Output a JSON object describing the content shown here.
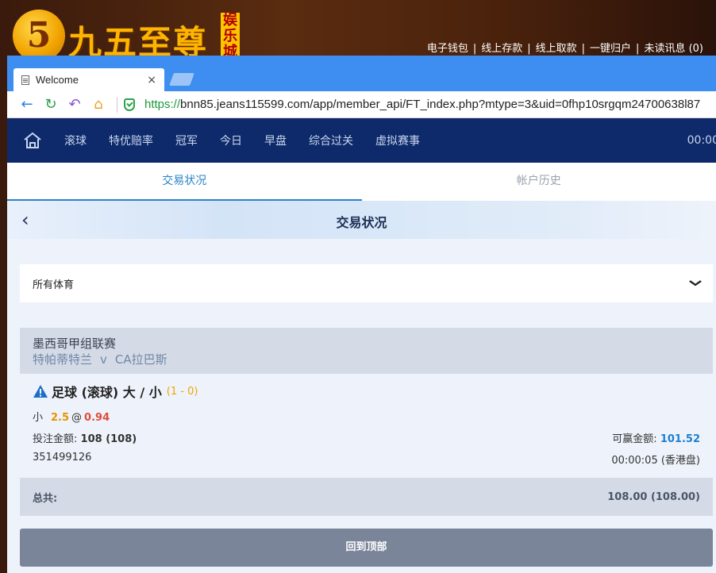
{
  "site": {
    "logo_digit": "5",
    "logo_text": "九五至尊",
    "logo_sub": "娱乐城",
    "links": [
      "电子钱包",
      "线上存款",
      "线上取款",
      "一键归户",
      "未读讯息 (0)"
    ],
    "separator": "|"
  },
  "browser": {
    "tab_title": "Welcome",
    "tab_close": "×",
    "url_scheme": "https://",
    "url_rest": "bnn85.jeans115599.com/app/member_api/FT_index.php?mtype=3&uid=0fhp10srgqm24700638l87"
  },
  "nav": {
    "items": [
      "滚球",
      "特优赔率",
      "冠军",
      "今日",
      "早盘",
      "综合过关",
      "虚拟赛事"
    ],
    "time": "00:00"
  },
  "subtabs": [
    "交易状况",
    "帐户历史"
  ],
  "header": {
    "back_glyph": "‹",
    "title": "交易状况"
  },
  "filter": {
    "selected": "所有体育",
    "chevron": "⌄"
  },
  "bet": {
    "league": "墨西哥甲组联赛",
    "home_team": "特帕蒂特兰",
    "vs": "v",
    "away_team": "CA拉巴斯",
    "market": "足球 (滚球) 大 / 小",
    "score": "(1 - 0)",
    "pick": "小",
    "line": "2.5",
    "at": "@",
    "odds": "0.94",
    "stake_label": "投注金额:",
    "stake_value": "108 (108)",
    "win_label": "可赢金额:",
    "win_value": "101.52",
    "ticket_id": "351499126",
    "time_label": "00:00:05 (香港盘)"
  },
  "total": {
    "label": "总共:",
    "value": "108.00 (108.00)"
  },
  "back_to_top": "回到顶部",
  "colors": {
    "nav_bg": "#0e2a6a",
    "accent_blue": "#2a84c6",
    "odds_red": "#e04c3c",
    "line_orange": "#e79300",
    "win_blue": "#1c7fd1"
  }
}
